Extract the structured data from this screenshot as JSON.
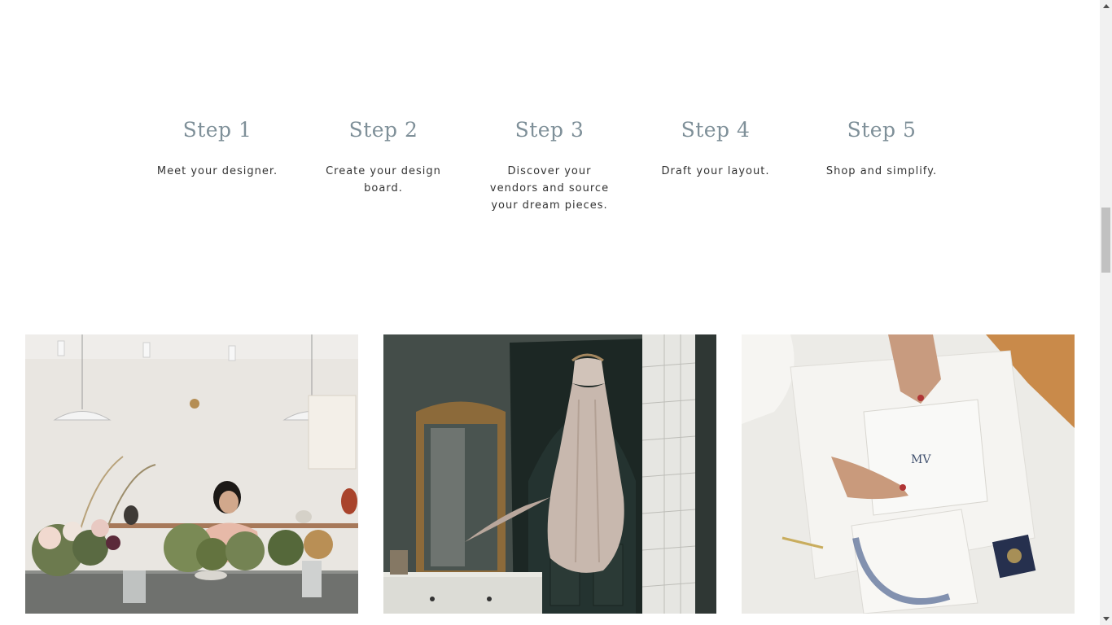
{
  "steps": [
    {
      "title": "Step 1",
      "text": "Meet your designer."
    },
    {
      "title": "Step 2",
      "text": "Create your design board."
    },
    {
      "title": "Step 3",
      "text": "Discover your vendors and source your dream pieces."
    },
    {
      "title": "Step 4",
      "text": "Draft your layout."
    },
    {
      "title": "Step 5",
      "text": "Shop and simplify."
    }
  ],
  "images": [
    {
      "subject": "florist arranging flowers on a kitchen counter"
    },
    {
      "subject": "dress hanging on a dark open door beside a gilded mirror"
    },
    {
      "subject": "hands holding wedding invitation suite"
    }
  ],
  "colors": {
    "step_title": "#7f9099",
    "step_text": "#333333",
    "background": "#ffffff"
  }
}
